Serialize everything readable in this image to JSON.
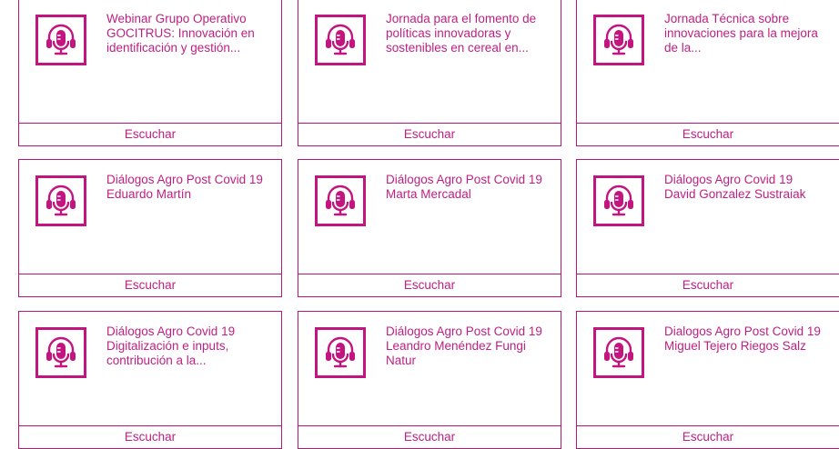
{
  "colors": {
    "accent": "#c3157f",
    "text": "#bf1f82",
    "border": "#b5167a"
  },
  "cards": [
    {
      "icon": "podcast-microphone-icon",
      "title": "Webinar Grupo Operativo GOCITRUS: Innovación en identificación y gestión...",
      "action": "Escuchar"
    },
    {
      "icon": "podcast-microphone-icon",
      "title": "Jornada para el fomento de políticas innovadoras y sostenibles en cereal en...",
      "action": "Escuchar"
    },
    {
      "icon": "podcast-microphone-icon",
      "title": "Jornada Técnica sobre innovaciones para la mejora de la...",
      "action": "Escuchar"
    },
    {
      "icon": "podcast-microphone-icon",
      "title": "Diálogos Agro Post Covid 19 Eduardo Martín",
      "action": "Escuchar"
    },
    {
      "icon": "podcast-microphone-icon",
      "title": "Diálogos Agro Post Covid 19 Marta Mercadal",
      "action": "Escuchar"
    },
    {
      "icon": "podcast-microphone-icon",
      "title": "Diálogos Agro Covid 19 David Gonzalez Sustraiak",
      "action": "Escuchar"
    },
    {
      "icon": "podcast-microphone-icon",
      "title": "Diálogos Agro Covid 19 Digitalización e inputs, contribución a la...",
      "action": "Escuchar"
    },
    {
      "icon": "podcast-microphone-icon",
      "title": "Diálogos Agro Post Covid 19 Leandro Menéndez Fungi Natur",
      "action": "Escuchar"
    },
    {
      "icon": "podcast-microphone-icon",
      "title": "Dialogos Agro Post Covid 19 Miguel Tejero Riegos Salz",
      "action": "Escuchar"
    }
  ]
}
